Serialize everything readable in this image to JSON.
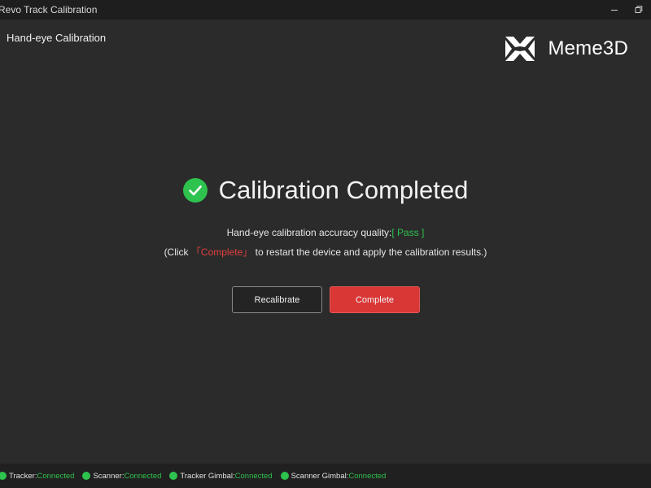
{
  "window": {
    "title": "Revo Track Calibration"
  },
  "page": {
    "title": "Hand-eye Calibration"
  },
  "logo": {
    "name": "Meme3D"
  },
  "result": {
    "heading": "Calibration Completed",
    "quality_label": "Hand-eye calibration accuracy quality:",
    "quality_value": "[ Pass ]",
    "hint_prefix": "(Click",
    "hint_highlight": "「Complete」",
    "hint_suffix": "to restart the device and apply the calibration results.)"
  },
  "buttons": {
    "recalibrate": "Recalibrate",
    "complete": "Complete"
  },
  "status": [
    {
      "label": "Tracker:",
      "value": "Connected"
    },
    {
      "label": "Scanner:",
      "value": "Connected"
    },
    {
      "label": "Tracker Gimbal:",
      "value": "Connected"
    },
    {
      "label": "Scanner Gimbal:",
      "value": "Connected"
    }
  ],
  "colors": {
    "success": "#2ec24e",
    "accent_red": "#d93636",
    "background": "#2b2b2b"
  },
  "icons": {
    "result": "check-circle-icon",
    "logo": "meme3d-logo-icon",
    "minimize": "minimize-icon",
    "restore": "restore-icon"
  }
}
